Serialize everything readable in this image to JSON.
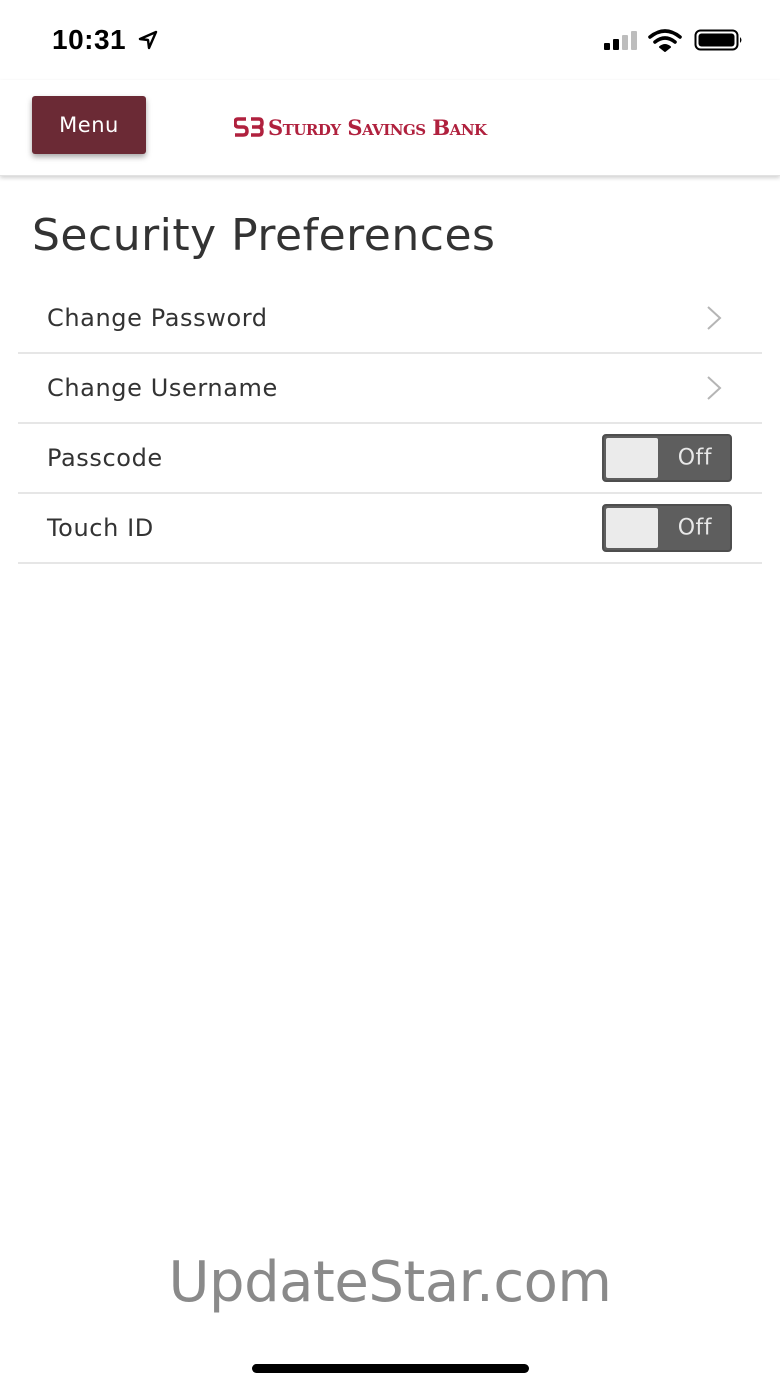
{
  "status_bar": {
    "time": "10:31"
  },
  "header": {
    "menu_label": "Menu",
    "brand_name": "Sturdy Savings Bank",
    "brand_color": "#b0213e",
    "menu_color": "#6b2a35"
  },
  "page": {
    "title": "Security Preferences"
  },
  "settings": [
    {
      "label": "Change Password",
      "type": "link",
      "icon": "chevron-right-icon"
    },
    {
      "label": "Change Username",
      "type": "link",
      "icon": "chevron-right-icon"
    },
    {
      "label": "Passcode",
      "type": "toggle",
      "state": "Off"
    },
    {
      "label": "Touch ID",
      "type": "toggle",
      "state": "Off"
    }
  ],
  "watermark": "UpdateStar.com"
}
